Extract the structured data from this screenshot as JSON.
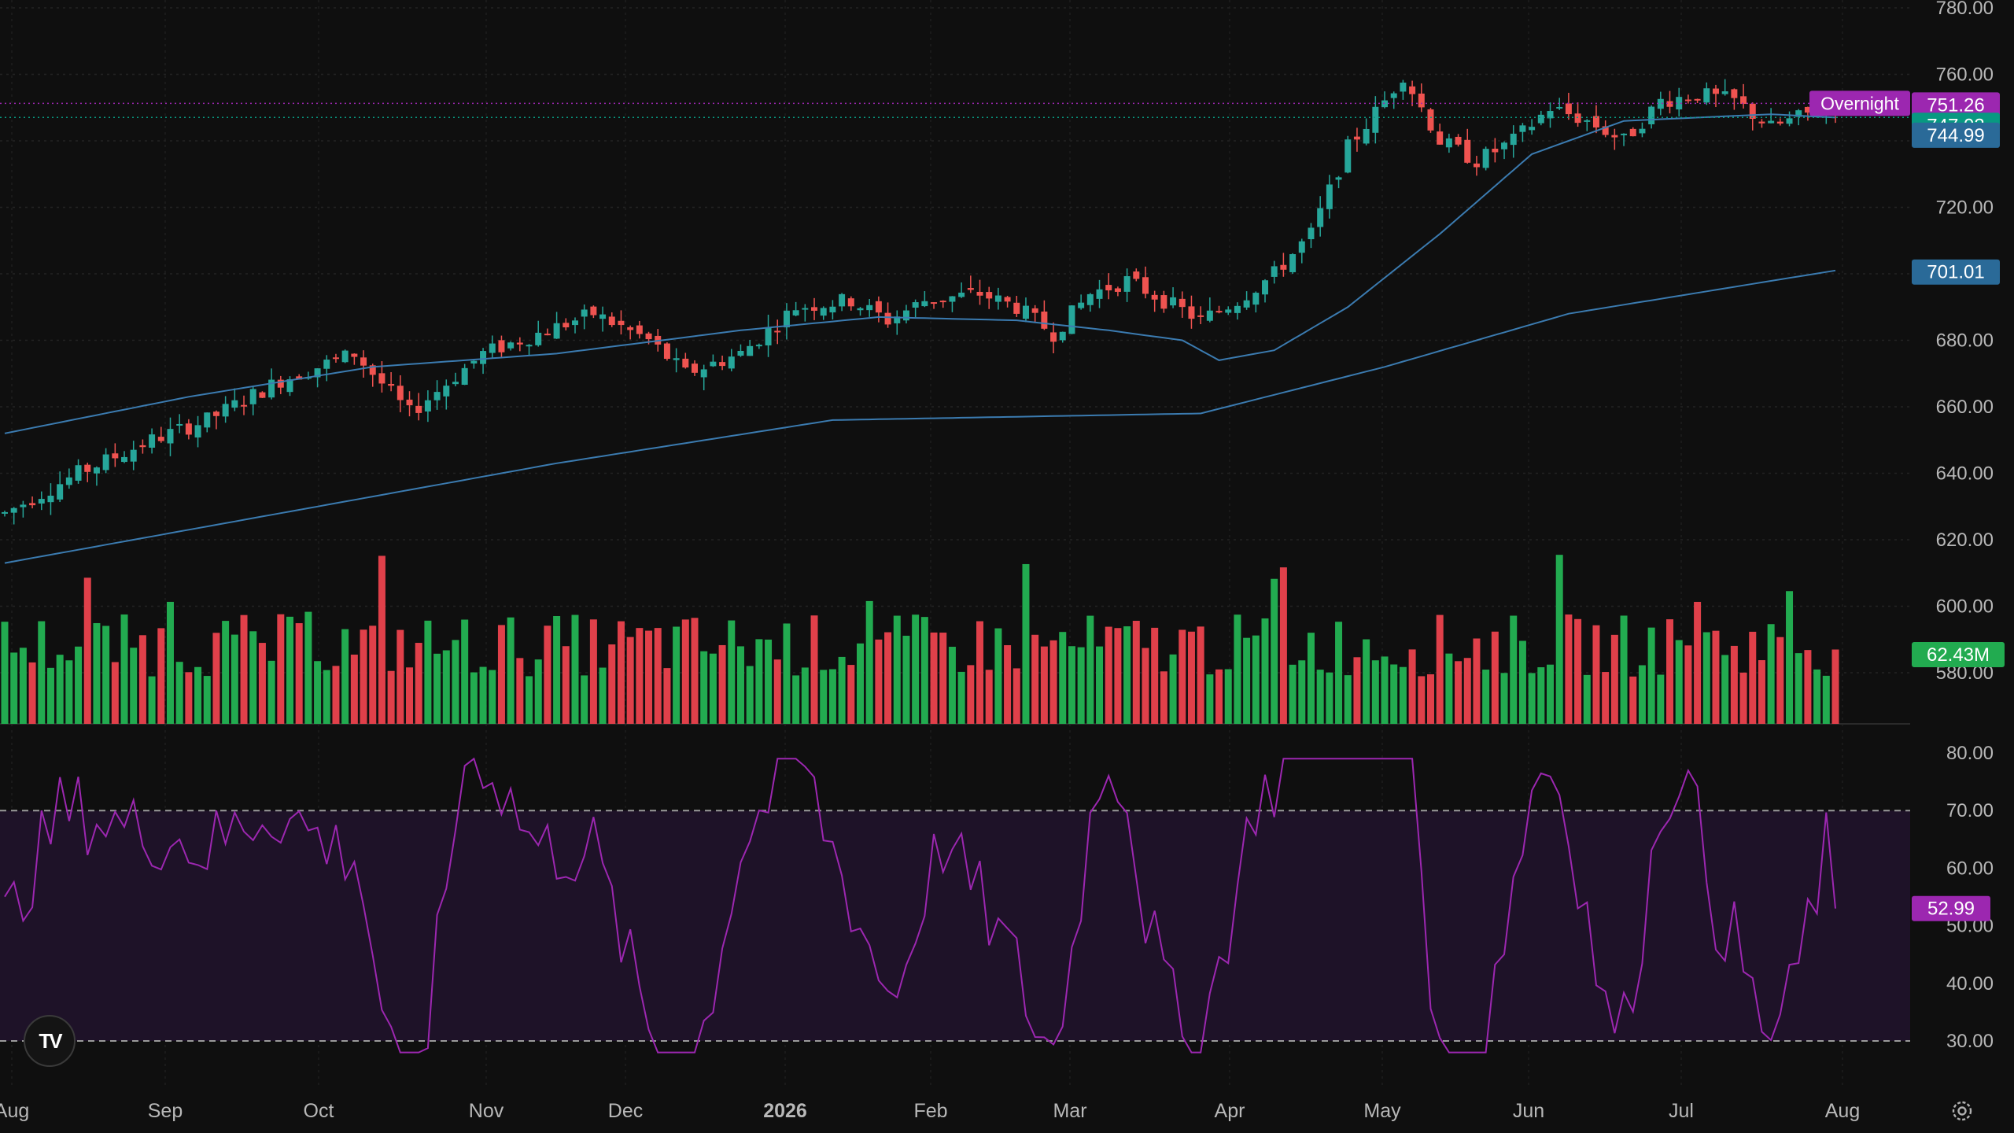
{
  "chart_data": [
    {
      "type": "candlestick",
      "panel": "price",
      "y_ticks": [
        "780.00",
        "760.00",
        "720.00",
        "680.00",
        "660.00",
        "640.00",
        "620.00",
        "600.00",
        "580.00"
      ],
      "ylim": [
        570,
        780
      ],
      "x_labels": [
        "Aug",
        "Sep",
        "Oct",
        "Nov",
        "Dec",
        "2026",
        "Feb",
        "Mar",
        "Apr",
        "May",
        "Jun",
        "Jul",
        "Aug"
      ],
      "price_path": [
        [
          0,
          628
        ],
        [
          8,
          640
        ],
        [
          16,
          650
        ],
        [
          22,
          656
        ],
        [
          30,
          668
        ],
        [
          38,
          676
        ],
        [
          44,
          658
        ],
        [
          52,
          676
        ],
        [
          58,
          682
        ],
        [
          64,
          688
        ],
        [
          70,
          680
        ],
        [
          74,
          670
        ],
        [
          80,
          676
        ],
        [
          86,
          690
        ],
        [
          92,
          692
        ],
        [
          96,
          686
        ],
        [
          100,
          692
        ],
        [
          106,
          694
        ],
        [
          110,
          690
        ],
        [
          114,
          682
        ],
        [
          118,
          694
        ],
        [
          122,
          698
        ],
        [
          126,
          692
        ],
        [
          130,
          686
        ],
        [
          134,
          692
        ],
        [
          138,
          700
        ],
        [
          142,
          712
        ],
        [
          146,
          738
        ],
        [
          150,
          752
        ],
        [
          152,
          760
        ],
        [
          156,
          740
        ],
        [
          160,
          734
        ],
        [
          164,
          740
        ],
        [
          168,
          750
        ],
        [
          172,
          746
        ],
        [
          176,
          740
        ],
        [
          180,
          752
        ],
        [
          184,
          754
        ],
        [
          188,
          752
        ],
        [
          192,
          744
        ],
        [
          196,
          748
        ],
        [
          199,
          751.26
        ]
      ],
      "ma50_path": [
        [
          0,
          652
        ],
        [
          20,
          663
        ],
        [
          40,
          672
        ],
        [
          60,
          676
        ],
        [
          80,
          683
        ],
        [
          95,
          687
        ],
        [
          110,
          686
        ],
        [
          120,
          683
        ],
        [
          128,
          680
        ],
        [
          132,
          674
        ],
        [
          138,
          677
        ],
        [
          146,
          690
        ],
        [
          156,
          712
        ],
        [
          166,
          736
        ],
        [
          176,
          746
        ],
        [
          192,
          748
        ],
        [
          199,
          747
        ]
      ],
      "ma200_path": [
        [
          0,
          613
        ],
        [
          30,
          628
        ],
        [
          60,
          643
        ],
        [
          90,
          656
        ],
        [
          110,
          657
        ],
        [
          130,
          658
        ],
        [
          150,
          672
        ],
        [
          170,
          688
        ],
        [
          199,
          701
        ]
      ],
      "overlays": [
        {
          "label": "Overnight",
          "value": "751.26",
          "color": "#9c27b0"
        },
        {
          "value": "747.03",
          "color": "#089981"
        },
        {
          "value": "744.99",
          "color": "#2a6a98"
        },
        {
          "value": "701.01",
          "color": "#2a6a98"
        }
      ],
      "colors": {
        "up": "#26a69a",
        "down": "#ef5350",
        "ma": "#3b7bb0",
        "bull_volume": "#22c55e",
        "bear_volume": "#ef4444"
      }
    },
    {
      "type": "bar",
      "panel": "volume",
      "last_value": "62.43M",
      "colors": {
        "up": "#22ab50",
        "down": "#e0404a"
      }
    },
    {
      "type": "line",
      "panel": "rsi",
      "y_ticks": [
        "80.00",
        "70.00",
        "60.00",
        "50.00",
        "40.00",
        "30.00"
      ],
      "ylim": [
        25,
        82
      ],
      "bands": [
        30,
        70
      ],
      "last_value": "52.99",
      "color": "#9c27b0"
    }
  ]
}
